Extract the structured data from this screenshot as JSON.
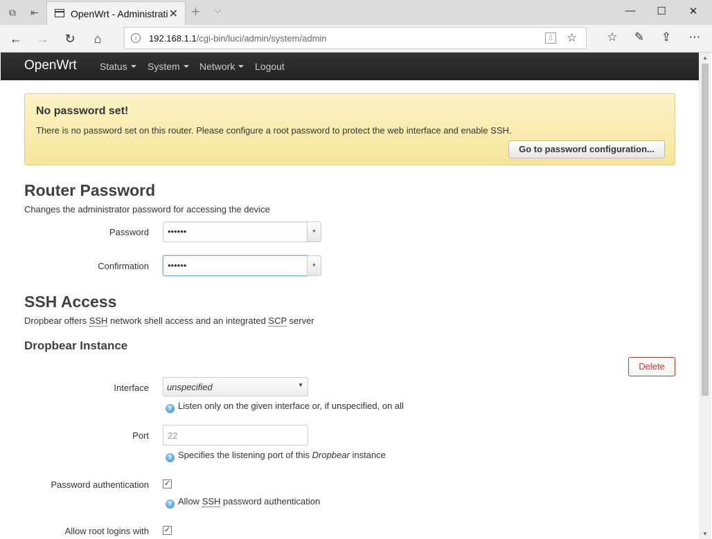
{
  "browser": {
    "tab_title": "OpenWrt - Administrati",
    "url_host": "192.168.1.1",
    "url_path": "/cgi-bin/luci/admin/system/admin"
  },
  "navbar": {
    "brand": "OpenWrt",
    "menus": [
      "Status",
      "System",
      "Network"
    ],
    "logout": "Logout"
  },
  "alert": {
    "title": "No password set!",
    "message": "There is no password set on this router. Please configure a root password to protect the web interface and enable SSH.",
    "button": "Go to password configuration..."
  },
  "router_password": {
    "title": "Router Password",
    "description": "Changes the administrator password for accessing the device",
    "password_label": "Password",
    "password_value": "••••••",
    "confirmation_label": "Confirmation",
    "confirmation_value": "••••••",
    "reveal_glyph": "*"
  },
  "ssh": {
    "title": "SSH Access",
    "desc_prefix": "Dropbear offers ",
    "desc_ssh": "SSH",
    "desc_mid": " network shell access and an integrated ",
    "desc_scp": "SCP",
    "desc_suffix": " server",
    "instance_title": "Dropbear Instance",
    "delete_button": "Delete",
    "interface_label": "Interface",
    "interface_value": "unspecified",
    "interface_help": "Listen only on the given interface or, if unspecified, on all",
    "port_label": "Port",
    "port_placeholder": "22",
    "port_help_prefix": "Specifies the listening port of this ",
    "port_help_em": "Dropbear",
    "port_help_suffix": " instance",
    "pwauth_label": "Password authentication",
    "pwauth_help_prefix": "Allow ",
    "pwauth_help_abbr": "SSH",
    "pwauth_help_suffix": " password authentication",
    "root_label": "Allow root logins with"
  }
}
